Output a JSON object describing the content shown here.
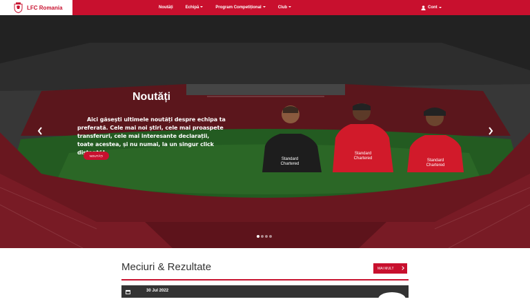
{
  "navbar": {
    "brand": "LFC Romania",
    "links": [
      {
        "label": "Noutăți",
        "dropdown": false
      },
      {
        "label": "Echipă",
        "dropdown": true
      },
      {
        "label": "Program Competițional",
        "dropdown": true
      },
      {
        "label": "Club",
        "dropdown": true
      }
    ],
    "account_label": "Cont"
  },
  "hero": {
    "title": "Noutăți",
    "text": "Aici găsești ultimele noutăți despre echipa ta preferată. Cele mai noi știri, cele mai proaspete transferuri, cele mai interesante declarații, toate acestea, și nu numai, la un singur click distanță!",
    "button": "NOUTĂȚI",
    "slides": 4,
    "active_slide": 1,
    "sponsor": "Standard Chartered"
  },
  "results": {
    "title": "Meciuri & Rezultate",
    "more_button": "MAI MULT",
    "first_match_date": "30 Jul 2022"
  },
  "colors": {
    "brand_red": "#c8102e",
    "dark_bar": "#333333"
  },
  "icons": [
    "lfc-crest-icon",
    "caret-down-icon",
    "user-icon",
    "chevron-left-icon",
    "chevron-right-icon",
    "chevron-right-small-icon",
    "calendar-icon"
  ]
}
